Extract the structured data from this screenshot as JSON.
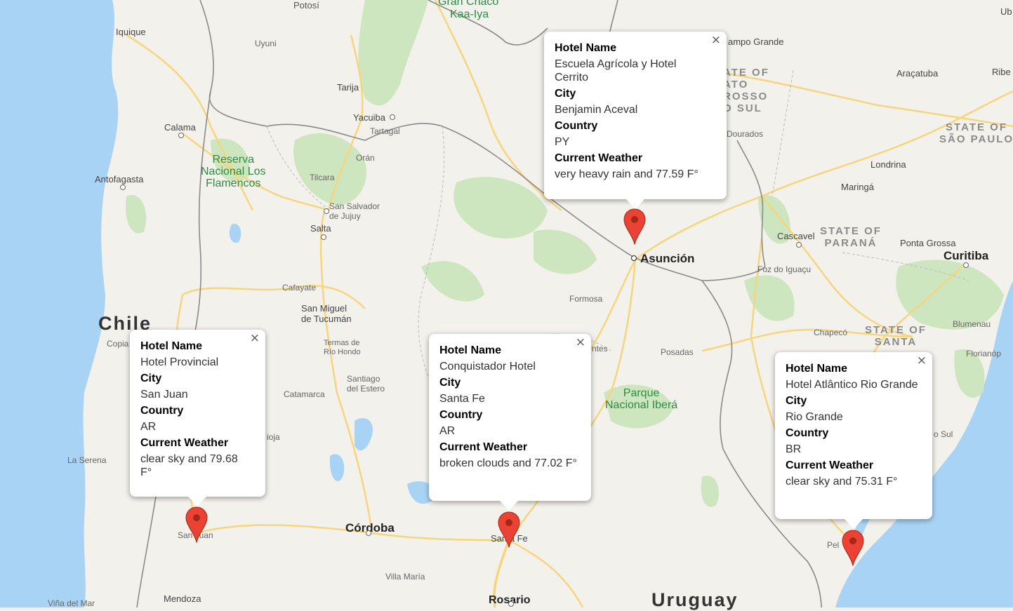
{
  "map": {
    "labels": {
      "potosi": "Potosí",
      "gran_chaco": "Gran Chaco",
      "kaa_iya": "Kaa-Iya",
      "iquique": "Iquique",
      "uyuni": "Uyuni",
      "tarija": "Tarija",
      "calama": "Calama",
      "yacuiba": "Yacuiba",
      "tartagal": "Tartagal",
      "oran": "Orán",
      "reserva": "Reserva\nNacional Los\nFlamencos",
      "antofagasta": "Antofagasta",
      "tilcara": "Tilcara",
      "san_salvador": "San Salvador\nde Jujuy",
      "salta": "Salta",
      "cafayate": "Cafayate",
      "san_miguel": "San Miguel\nde Tucumán",
      "chile": "Chile",
      "copiapo": "Copia",
      "termas": "Termas de\nRío Hondo",
      "santiago_estero": "Santiago\ndel Estero",
      "catamarca": "Catamarca",
      "rioja": "ioja",
      "la_serena": "La Serena",
      "cordoba": "Córdoba",
      "san_juan": "San Juan",
      "villa_maria": "Villa María",
      "mendoza": "Mendoza",
      "vina": "Viña del Mar",
      "rosario": "Rosario",
      "santa_fe": "Santa Fe",
      "uruguay": "Uruguay",
      "asuncion": "Asunción",
      "formosa": "Formosa",
      "ntes": "ntes",
      "posadas": "Posadas",
      "parque_ibera": "Parque\nNacional Iberá",
      "campo_grande": "ampo Grande",
      "mato_grosso": "ATE OF\nATO\nROSSO\nO SUL",
      "dourados": "Dourados",
      "aracatuba": "Araçatuba",
      "ribe": "Ribe",
      "ub": "Ub",
      "state_sao_paulo": "STATE OF\nSÃO PAULO",
      "londrina": "Londrina",
      "maringa": "Maringá",
      "cascavel": "Cascavel",
      "state_parana": "STATE OF\nPARANÁ",
      "ponta_grossa": "Ponta Grossa",
      "curitiba": "Curitiba",
      "foz": "Foz do Iguaçu",
      "blumenau": "Blumenau",
      "chapeco": "Chapecó",
      "state_santa": "STATE OF\nSANTA",
      "florianopolis": "Florianóp",
      "o_sul": "o Sul",
      "pelotas": "Pel"
    }
  },
  "infowindows": [
    {
      "close_glyph": "×",
      "fields": [
        {
          "label": "Hotel Name",
          "value": "Escuela Agrícola y Hotel Cerrito"
        },
        {
          "label": "City",
          "value": "Benjamin Aceval"
        },
        {
          "label": "Country",
          "value": "PY"
        },
        {
          "label": "Current Weather",
          "value": "very heavy rain and 77.59 F°"
        }
      ]
    },
    {
      "close_glyph": "×",
      "fields": [
        {
          "label": "Hotel Name",
          "value": "Hotel Provincial"
        },
        {
          "label": "City",
          "value": "San Juan"
        },
        {
          "label": "Country",
          "value": "AR"
        },
        {
          "label": "Current Weather",
          "value": "clear sky and 79.68 F°"
        }
      ]
    },
    {
      "close_glyph": "×",
      "fields": [
        {
          "label": "Hotel Name",
          "value": "Conquistador Hotel"
        },
        {
          "label": "City",
          "value": "Santa Fe"
        },
        {
          "label": "Country",
          "value": "AR"
        },
        {
          "label": "Current Weather",
          "value": "broken clouds and 77.02 F°"
        }
      ]
    },
    {
      "close_glyph": "×",
      "fields": [
        {
          "label": "Hotel Name",
          "value": "Hotel Atlântico Rio Grande"
        },
        {
          "label": "City",
          "value": "Rio Grande"
        },
        {
          "label": "Country",
          "value": "BR"
        },
        {
          "label": "Current Weather",
          "value": "clear sky and 75.31 F°"
        }
      ]
    }
  ],
  "colors": {
    "land": "#f3f1ec",
    "water": "#a9d3f5",
    "park": "#cde6bf",
    "road": "#f7d57c",
    "border": "#8a8a8a",
    "marker": "#ea4335"
  }
}
